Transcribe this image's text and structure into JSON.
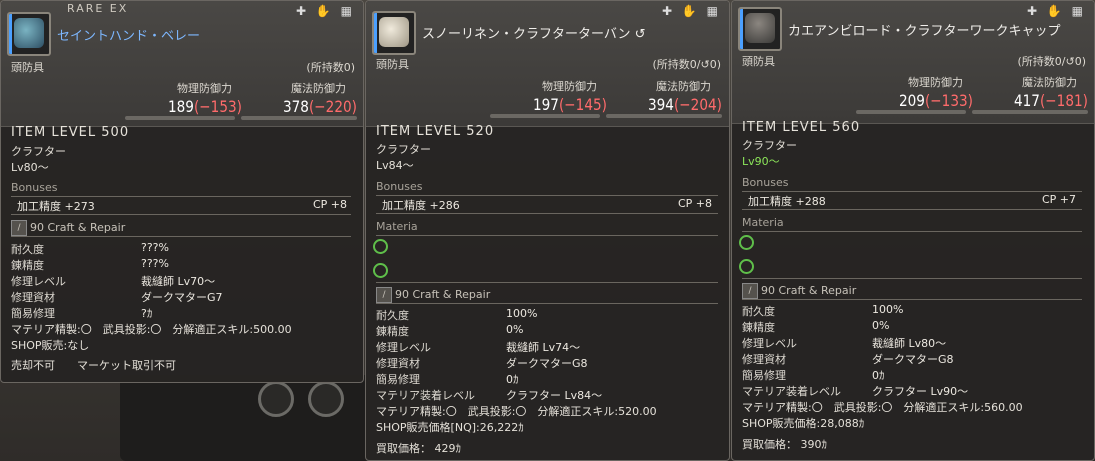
{
  "panels": [
    {
      "tags": "RARE   EX",
      "name": "セイントハンド・ベレー",
      "slot": "頭防具",
      "owned": "(所持数0)",
      "phys_label": "物理防御力",
      "mag_label": "魔法防御力",
      "phys_val": "189",
      "phys_delta": "(−153)",
      "mag_val": "378",
      "mag_delta": "(−220)",
      "ilvl": "ITEM LEVEL 500",
      "job": "クラフター",
      "level": "Lv80〜",
      "bonuses_title": "Bonuses",
      "bonus_left": "加工精度 +273",
      "bonus_right": "CP +8",
      "craft_label": "90 Craft & Repair",
      "rows": [
        {
          "k": "耐久度",
          "v": "???%"
        },
        {
          "k": "錬精度",
          "v": "???%"
        },
        {
          "k": "修理レベル",
          "v": "裁縫師 Lv70〜"
        },
        {
          "k": "修理資材",
          "v": "ダークマターG7"
        },
        {
          "k": "簡易修理",
          "v": "?ｶ"
        }
      ],
      "line1": "マテリア精製:〇　武具投影:〇　分解適正スキル:500.00",
      "line2": "SHOP販売:なし",
      "line3": "売却不可　　マーケット取引不可"
    },
    {
      "name": "スノーリネン・クラフターターバン",
      "slot": "頭防具",
      "owned": "(所持数0/",
      "owned_hq": "0)",
      "phys_label": "物理防御力",
      "mag_label": "魔法防御力",
      "phys_val": "197",
      "phys_delta": "(−145)",
      "mag_val": "394",
      "mag_delta": "(−204)",
      "ilvl": "ITEM LEVEL 520",
      "job": "クラフター",
      "level": "Lv84〜",
      "bonuses_title": "Bonuses",
      "bonus_left": "加工精度 +286",
      "bonus_right": "CP +8",
      "materia_title": "Materia",
      "craft_label": "90 Craft & Repair",
      "rows": [
        {
          "k": "耐久度",
          "v": "100%"
        },
        {
          "k": "錬精度",
          "v": "0%"
        },
        {
          "k": "修理レベル",
          "v": "裁縫師 Lv74〜"
        },
        {
          "k": "修理資材",
          "v": "ダークマターG8"
        },
        {
          "k": "簡易修理",
          "v": "0ｶ"
        },
        {
          "k": "マテリア装着レベル",
          "v": "クラフター Lv84〜"
        }
      ],
      "line1": "マテリア精製:〇　武具投影:〇　分解適正スキル:520.00",
      "line2": "SHOP販売価格[NQ]:26,222ｶ",
      "line3": "買取価格： 429ｶ"
    },
    {
      "name": "カエアンビロード・クラフターワークキャップ",
      "slot": "頭防具",
      "owned": "(所持数0/",
      "owned_hq": "0)",
      "phys_label": "物理防御力",
      "mag_label": "魔法防御力",
      "phys_val": "209",
      "phys_delta": "(−133)",
      "mag_val": "417",
      "mag_delta": "(−181)",
      "ilvl": "ITEM LEVEL 560",
      "job": "クラフター",
      "level": "Lv90〜",
      "bonuses_title": "Bonuses",
      "bonus_left": "加工精度 +288",
      "bonus_right": "CP +7",
      "materia_title": "Materia",
      "craft_label": "90 Craft & Repair",
      "rows": [
        {
          "k": "耐久度",
          "v": "100%"
        },
        {
          "k": "錬精度",
          "v": "0%"
        },
        {
          "k": "修理レベル",
          "v": "裁縫師 Lv80〜"
        },
        {
          "k": "修理資材",
          "v": "ダークマターG8"
        },
        {
          "k": "簡易修理",
          "v": "0ｶ"
        },
        {
          "k": "マテリア装着レベル",
          "v": "クラフター Lv90〜"
        }
      ],
      "line1": "マテリア精製:〇　武具投影:〇　分解適正スキル:560.00",
      "line2": "SHOP販売価格:28,088ｶ",
      "line3": "買取価格： 390ｶ"
    }
  ],
  "header_icons": "✚ ✋ ▦",
  "hq_icon": "↺",
  "colors": {
    "level_ok": "#8ce65a",
    "delta": "#ff6b6b",
    "name": "#7db7ff",
    "materia": "#5fbf4a"
  }
}
